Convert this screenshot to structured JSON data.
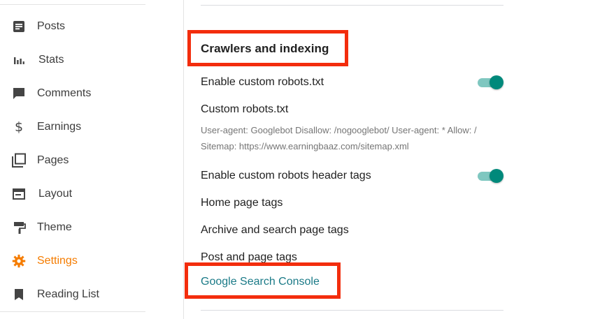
{
  "sidebar": {
    "items": [
      {
        "label": "Posts",
        "icon": "posts-icon"
      },
      {
        "label": "Stats",
        "icon": "stats-icon"
      },
      {
        "label": "Comments",
        "icon": "comments-icon"
      },
      {
        "label": "Earnings",
        "icon": "dollar-icon"
      },
      {
        "label": "Pages",
        "icon": "pages-icon"
      },
      {
        "label": "Layout",
        "icon": "layout-icon"
      },
      {
        "label": "Theme",
        "icon": "paint-roller-icon"
      },
      {
        "label": "Settings",
        "icon": "gear-icon",
        "active": true
      },
      {
        "label": "Reading List",
        "icon": "bookmark-icon"
      }
    ]
  },
  "main": {
    "section_title": "Crawlers and indexing",
    "enable_custom_robots_txt": {
      "label": "Enable custom robots.txt",
      "enabled": true
    },
    "custom_robots_txt": {
      "label": "Custom robots.txt",
      "value_line1": "User-agent: Googlebot Disallow: /nogooglebot/ User-agent: * Allow: /",
      "value_line2": "Sitemap: https://www.earningbaaz.com/sitemap.xml"
    },
    "enable_custom_robots_header_tags": {
      "label": "Enable custom robots header tags",
      "enabled": true
    },
    "home_page_tags": "Home page tags",
    "archive_search_page_tags": "Archive and search page tags",
    "post_page_tags": "Post and page tags",
    "google_search_console": "Google Search Console"
  },
  "colors": {
    "accent_active": "#f57c00",
    "toggle_on": "#00897b",
    "link": "#1a7a87",
    "highlight": "#f32d0d"
  }
}
